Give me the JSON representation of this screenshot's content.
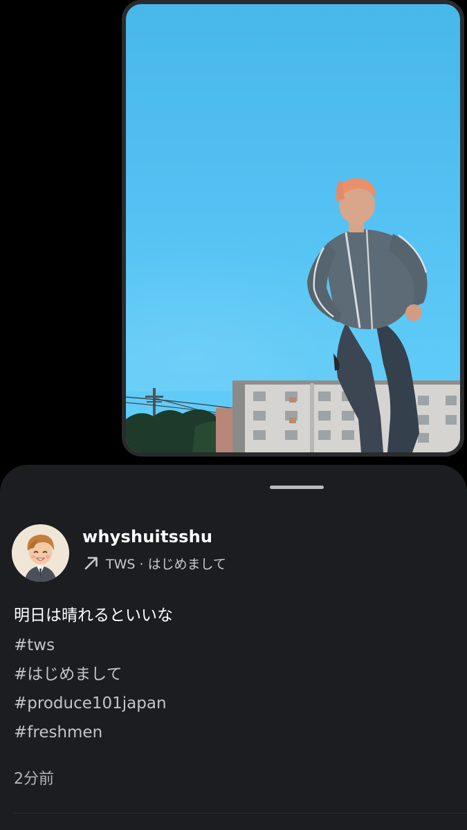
{
  "video": {
    "description_icon": "video-frame"
  },
  "post": {
    "username": "whyshuitsshu",
    "meta": "TWS · はじめまして",
    "meta_icon": "arrow-up-right-icon",
    "caption": "明日は晴れるといいな",
    "hashtags": [
      "#tws",
      "#はじめまして",
      "#produce101japan",
      "#freshmen"
    ],
    "timestamp": "2分前"
  },
  "colors": {
    "sheet_bg": "#1b1d20",
    "sky": "#53c1f2",
    "text_primary": "#ffffff",
    "text_secondary": "#c3c5c7"
  }
}
